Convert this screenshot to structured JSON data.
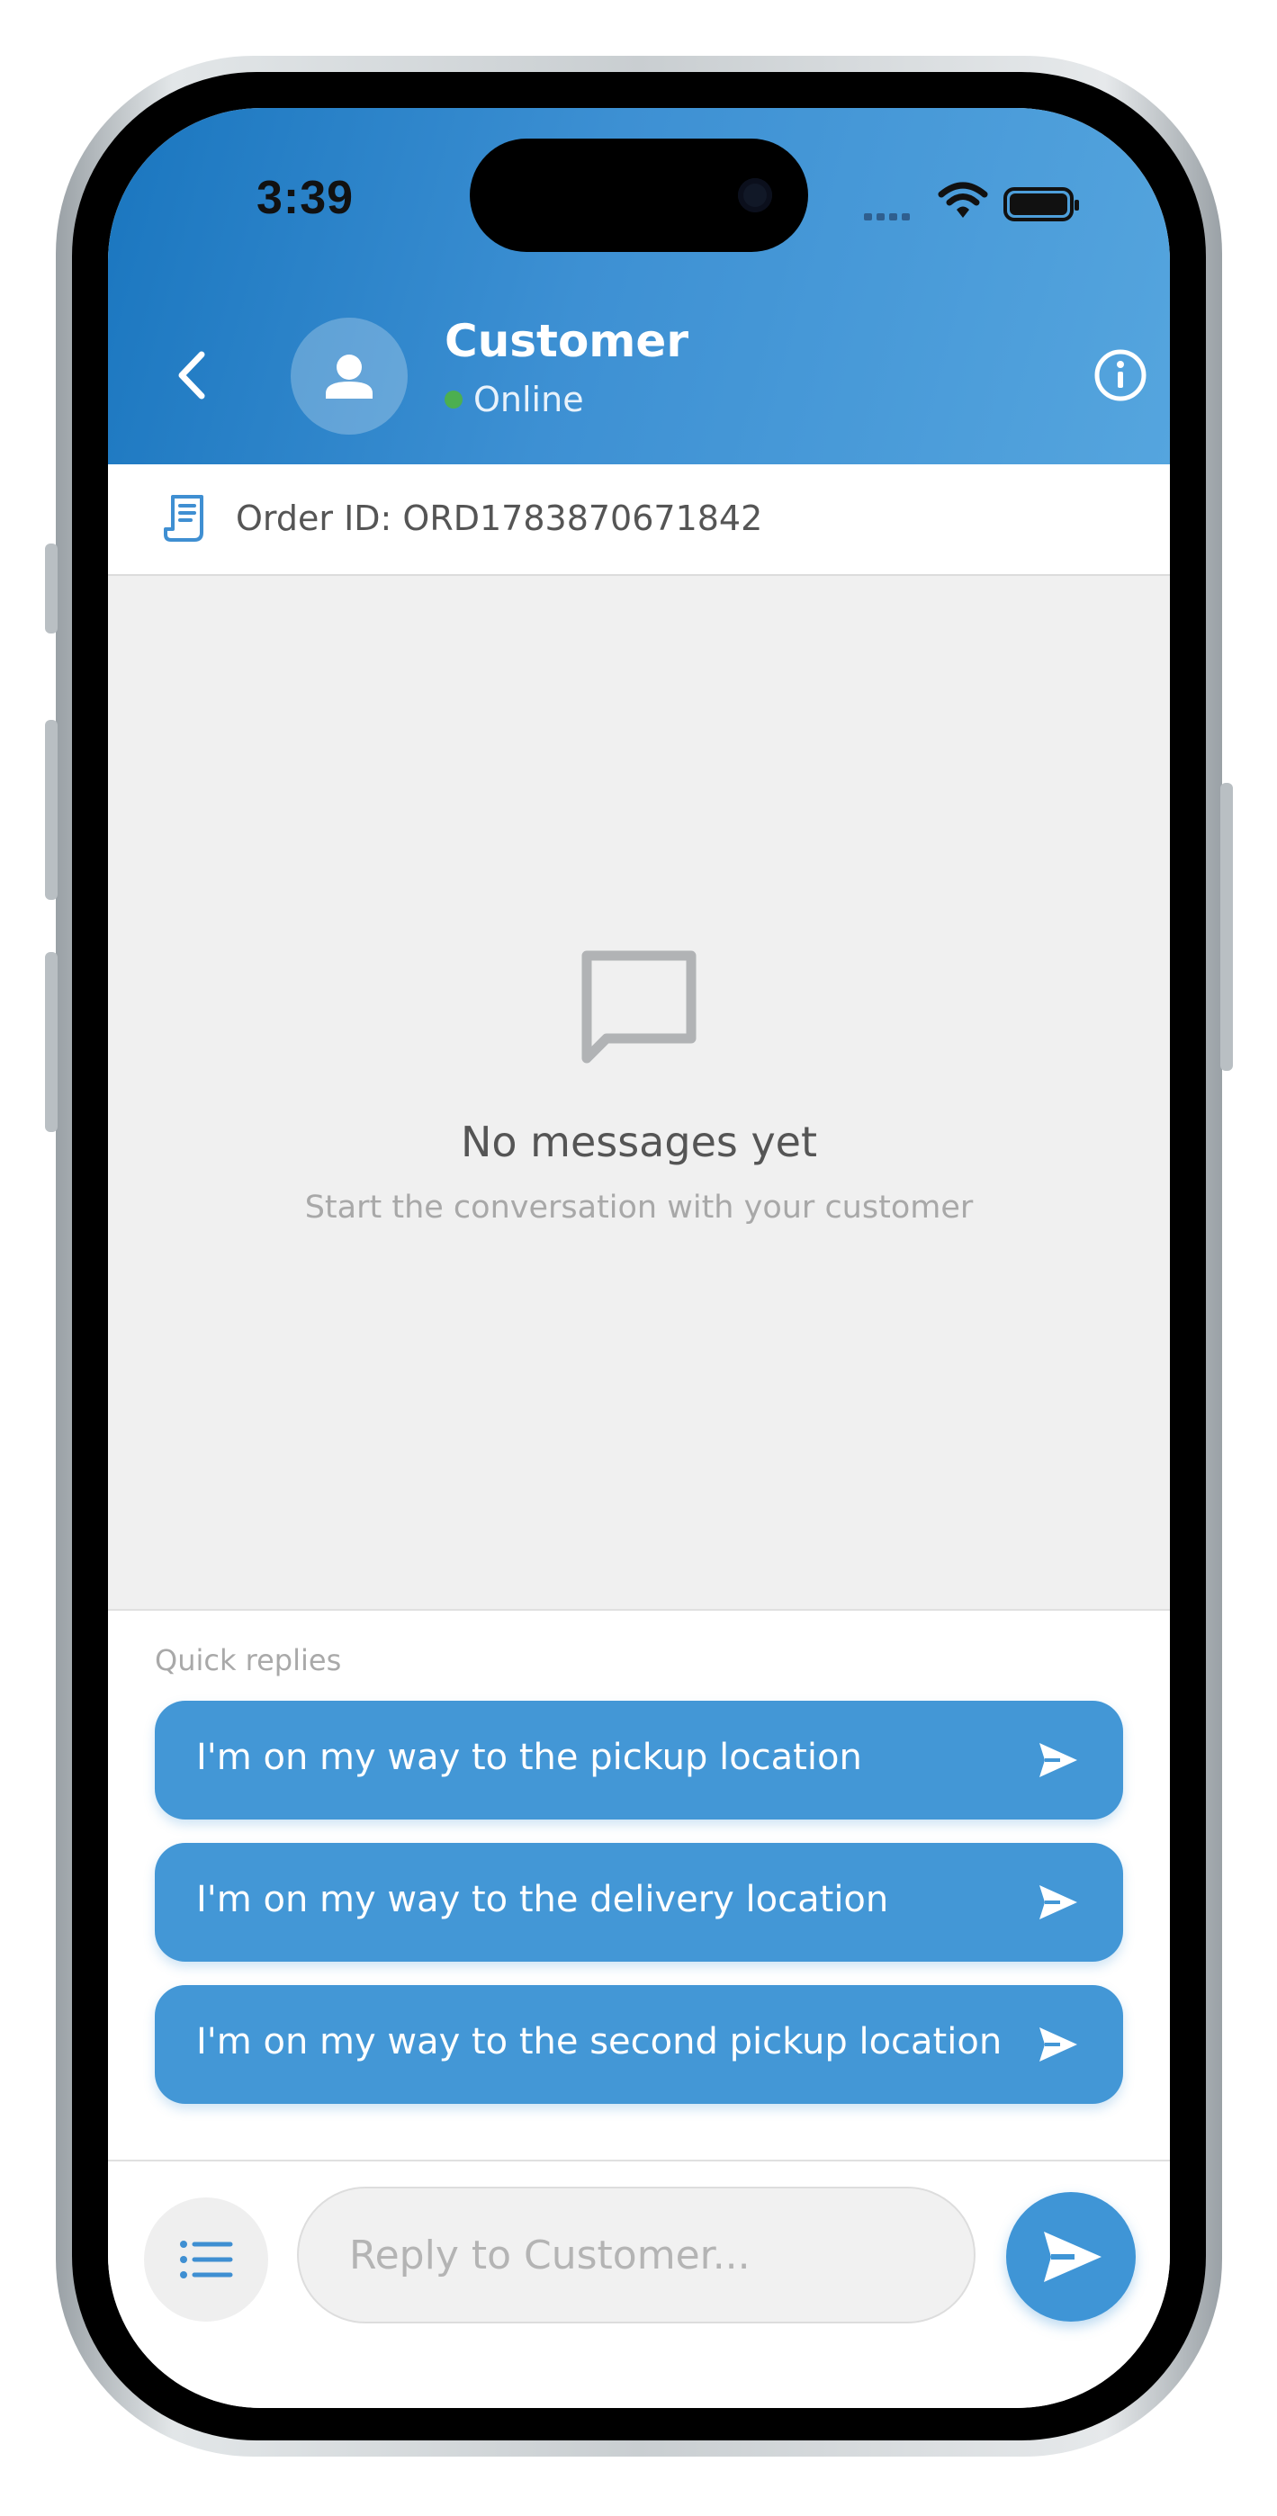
{
  "status_bar": {
    "time": "3:39"
  },
  "header": {
    "title": "Customer",
    "status": "Online",
    "status_color": "#4caf50",
    "accent": "#1a76bf"
  },
  "order": {
    "label": "Order ID: ORD1783870671842"
  },
  "empty_state": {
    "title": "No messages yet",
    "subtitle": "Start the conversation with your customer"
  },
  "quick_replies": {
    "label": "Quick replies",
    "items": [
      {
        "text": "I'm on my way to the pickup location"
      },
      {
        "text": "I'm on my way to the delivery location"
      },
      {
        "text": "I'm on my way to the second pickup location"
      }
    ]
  },
  "composer": {
    "placeholder": "Reply to Customer..."
  },
  "icons": {
    "back": "chevron-left-icon",
    "avatar": "person-icon",
    "info": "info-icon",
    "order": "receipt-icon",
    "empty": "chat-bubble-icon",
    "quick_send": "send-icon",
    "list": "list-icon",
    "send": "send-icon"
  }
}
